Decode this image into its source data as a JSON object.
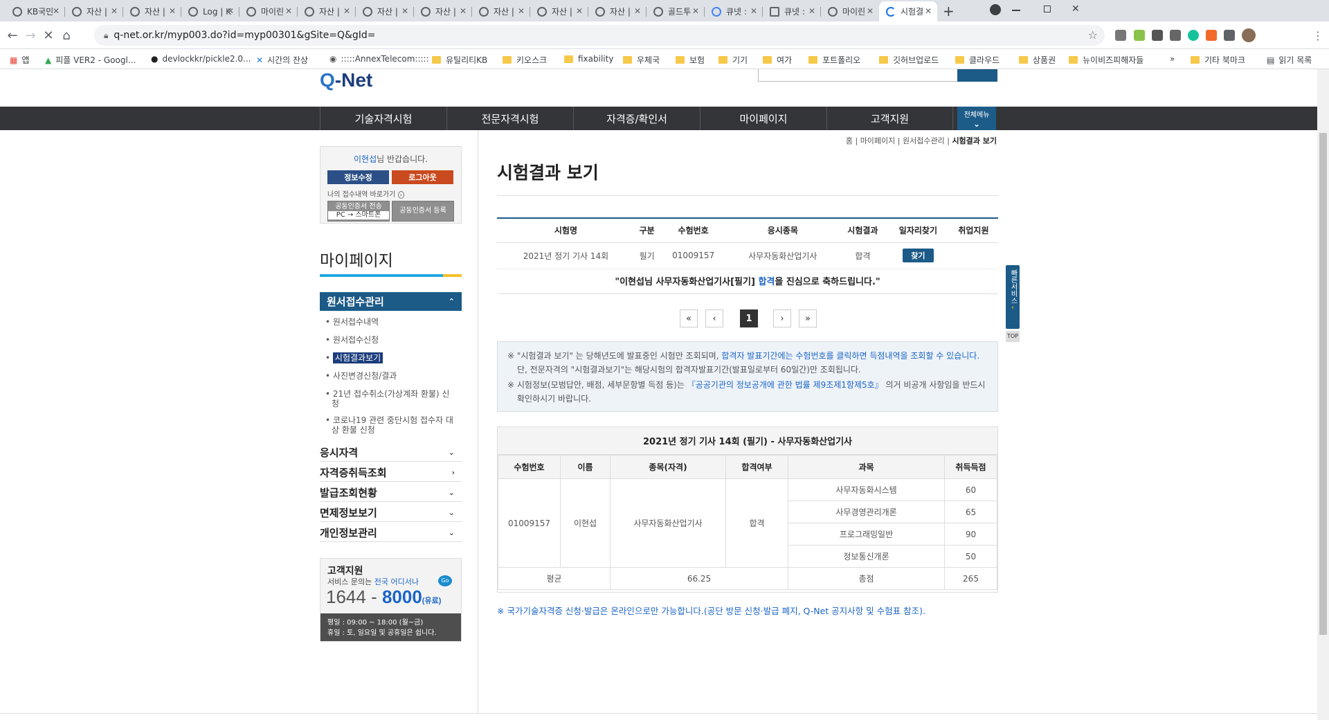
{
  "browser": {
    "tabs": [
      {
        "title": "KB국민"
      },
      {
        "title": "자산 |"
      },
      {
        "title": "자산 |"
      },
      {
        "title": "Log | K"
      },
      {
        "title": "마이린"
      },
      {
        "title": "자산 |"
      },
      {
        "title": "자산 |"
      },
      {
        "title": "자산 |"
      },
      {
        "title": "자산 |"
      },
      {
        "title": "자산 |"
      },
      {
        "title": "자산 |"
      },
      {
        "title": "골드투"
      },
      {
        "title": "큐넷 :"
      },
      {
        "title": "큐넷 :"
      },
      {
        "title": "마이린"
      },
      {
        "title": "시험결"
      }
    ],
    "new_tab": "+",
    "url": "q-net.or.kr/myp003.do?id=myp00301&gSite=Q&gId=",
    "bookmarks": [
      {
        "label": "앱",
        "icon": "apps-grid-icon"
      },
      {
        "label": "피플 VER2 - Googl...",
        "icon": "drive-icon"
      },
      {
        "label": "devlockkr/pickle2.0...",
        "icon": "github-icon"
      },
      {
        "label": "시간의 잔상",
        "icon": "link-icon"
      },
      {
        "label": ":::::AnnexTelecom:::::",
        "icon": "globe-icon"
      },
      {
        "label": "유틸리티KB",
        "icon": "folder-icon"
      },
      {
        "label": "키오스크",
        "icon": "folder-icon"
      },
      {
        "label": "fixability",
        "icon": "folder-icon"
      },
      {
        "label": "우체국",
        "icon": "folder-icon"
      },
      {
        "label": "보험",
        "icon": "folder-icon"
      },
      {
        "label": "기기",
        "icon": "folder-icon"
      },
      {
        "label": "여가",
        "icon": "folder-icon"
      },
      {
        "label": "포트폴리오",
        "icon": "folder-icon"
      },
      {
        "label": "깃허브업로드",
        "icon": "folder-icon"
      },
      {
        "label": "클라우드",
        "icon": "folder-icon"
      },
      {
        "label": "상품권",
        "icon": "folder-icon"
      },
      {
        "label": "뉴이비즈피해자들",
        "icon": "folder-icon"
      }
    ],
    "bookmarks_more": "»",
    "other_bookmarks": "기타 북마크",
    "reading_list": "읽기 목록"
  },
  "site": {
    "logo": "-Net",
    "logo_q": "Q",
    "gnb": [
      "기술자격시험",
      "전문자격시험",
      "자격증/확인서",
      "마이페이지",
      "고객지원"
    ],
    "all_menu": "전체메뉴"
  },
  "sidebar": {
    "user_name": "이현섭",
    "greeting_suffix": "님 반갑습니다.",
    "edit_info": "정보수정",
    "logout": "로그아웃",
    "shortcut": "나의 접수내역 바로가기",
    "cert_transfer_line1": "공동인증서 전송",
    "cert_transfer_line2": "PC → 스마트폰",
    "cert_register": "공동인증서 등록",
    "title": "마이페이지",
    "active_category": "원서접수관리",
    "sub_items": [
      "원서접수내역",
      "원서접수신청",
      "시험결과보기",
      "사진변경신청/결과",
      "21년 접수취소(가상계좌 환불) 신청",
      "코로나19 관련 중단시험 접수자 대상 환불 신청"
    ],
    "categories": [
      "응시자격",
      "자격증취득조회",
      "발급조회현황",
      "면제정보보기",
      "개인정보관리"
    ],
    "cs_title": "고객지원",
    "cs_sub": "서비스 문의는",
    "cs_sub_hl": "전국 어디서나",
    "cs_go": "Go",
    "cs_phone_a": "1644",
    "cs_phone_b": "8000",
    "cs_paid": "(유료)",
    "cs_hours1": "평일 : 09:00 ~ 18:00 (월~금)",
    "cs_hours2": "휴일 : 토, 일요일 및 공휴일은 쉽니다."
  },
  "main": {
    "breadcrumb": [
      "홈",
      "마이페이지",
      "원서접수관리",
      "시험결과 보기"
    ],
    "title": "시험결과 보기",
    "result_headers": [
      "시험명",
      "구분",
      "수험번호",
      "응시종목",
      "시험결과",
      "일자리찾기",
      "취업지원"
    ],
    "result_row": [
      "2021년 정기 기사 14회",
      "필기",
      "01009157",
      "사무자동화산업기사",
      "합격",
      "찾기",
      ""
    ],
    "congrats_pre": "\"이현섭님 사무자동화산업기사[필기]",
    "congrats_hl": "합격",
    "congrats_post": "을 진심으로 축하드립니다.\"",
    "pagination": [
      "«",
      "‹",
      "1",
      "›",
      "»"
    ],
    "notice1_a": "※ \"시험결과 보기\" 는 당해년도에 발표중인 시험만 조회되며,",
    "notice1_b": "합격자 발표기간에는 수험번호를 클릭하면 득점내역을 조회할 수 있습니다.",
    "notice1_c": "단, 전문자격의 \"시험결과보기\"는 해당시험의 합격자발표기간(발표일로부터 60일간)만 조회됩니다.",
    "notice2_a": "※ 시험정보(모범답안, 배점, 세부문항별 득점 등)는",
    "notice2_b": "『공공기관의 정보공개에 관한 법률 제9조제1항제5호』",
    "notice2_c": "의거 비공개 사항임을 반드시 확인하시기 바랍니다.",
    "score_caption": "2021년 정기 기사 14회 (필기) - 사무자동화산업기사",
    "score_headers": [
      "수험번호",
      "이름",
      "종목(자격)",
      "합격여부",
      "과목",
      "취득득점"
    ],
    "score_exam_no": "01009157",
    "score_name": "이현섭",
    "score_item": "사무자동화산업기사",
    "score_pass": "합격",
    "subjects": [
      {
        "name": "사무자동화시스템",
        "score": "60"
      },
      {
        "name": "사무경영관리개론",
        "score": "65"
      },
      {
        "name": "프로그래밍일반",
        "score": "90"
      },
      {
        "name": "정보통신개론",
        "score": "50"
      }
    ],
    "avg_label": "평균",
    "avg_value": "66.25",
    "total_label": "총점",
    "total_value": "265",
    "bottom_note": "※ 국가기술자격증 신청·발급은 온라인으로만 가능합니다.(공단 방문 신청·발급 폐지, Q-Net 공지사항 및 수험표 참조)."
  },
  "quick": {
    "label": "빠른서비스",
    "top": "TOP"
  }
}
